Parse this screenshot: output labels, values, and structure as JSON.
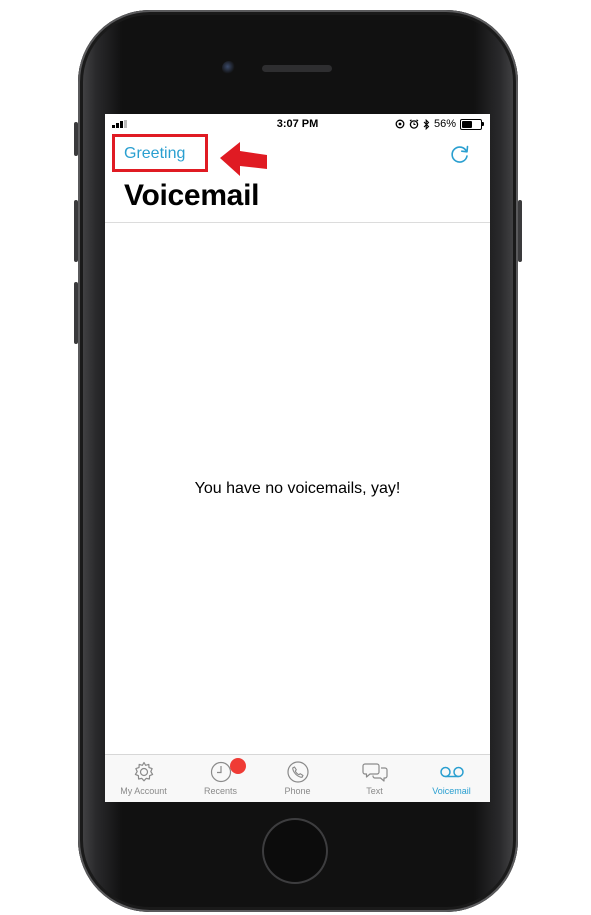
{
  "status_bar": {
    "time": "3:07 PM",
    "battery_percent": "56%",
    "battery_level": 0.56
  },
  "nav": {
    "greeting_label": "Greeting",
    "refresh_icon": "refresh-icon"
  },
  "page": {
    "title": "Voicemail",
    "empty_message": "You have no voicemails, yay!"
  },
  "tabs": [
    {
      "label": "My Account",
      "icon": "gear-icon",
      "active": false
    },
    {
      "label": "Recents",
      "icon": "clock-icon",
      "active": false,
      "badge": true
    },
    {
      "label": "Phone",
      "icon": "phone-icon",
      "active": false
    },
    {
      "label": "Text",
      "icon": "chat-bubbles-icon",
      "active": false
    },
    {
      "label": "Voicemail",
      "icon": "voicemail-icon",
      "active": true
    }
  ],
  "colors": {
    "accent": "#2a9fd0",
    "highlight": "#e01b23",
    "badge": "#ef3b35",
    "inactive": "#8a8a8a"
  }
}
